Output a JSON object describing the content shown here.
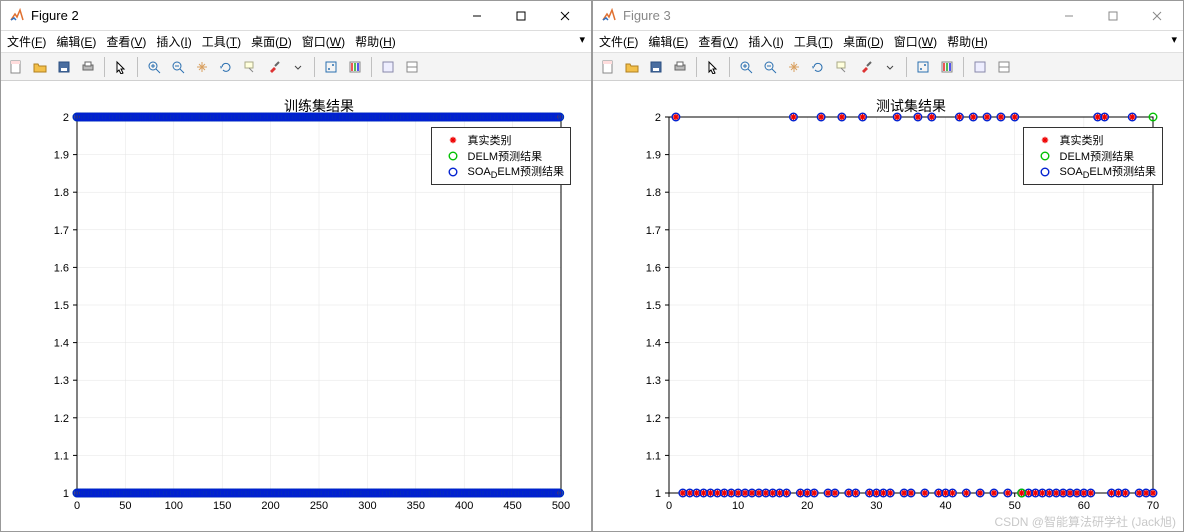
{
  "windows": [
    {
      "title": "Figure 2",
      "active": true,
      "chart": {
        "title": "训练集结果",
        "xticks": [
          0,
          50,
          100,
          150,
          200,
          250,
          300,
          350,
          400,
          450,
          500
        ],
        "yticks": [
          1,
          1.1,
          1.2,
          1.3,
          1.4,
          1.5,
          1.6,
          1.7,
          1.8,
          1.9,
          2
        ],
        "xlim": [
          0,
          500
        ],
        "ylim": [
          1,
          2
        ]
      }
    },
    {
      "title": "Figure 3",
      "active": false,
      "chart": {
        "title": "测试集结果",
        "xticks": [
          0,
          10,
          20,
          30,
          40,
          50,
          60,
          70
        ],
        "yticks": [
          1,
          1.1,
          1.2,
          1.3,
          1.4,
          1.5,
          1.6,
          1.7,
          1.8,
          1.9,
          2
        ],
        "xlim": [
          0,
          70
        ],
        "ylim": [
          1,
          2
        ]
      }
    }
  ],
  "menu": {
    "file": "文件(F)",
    "edit": "编辑(E)",
    "view": "查看(V)",
    "insert": "插入(I)",
    "tools": "工具(T)",
    "desktop": "桌面(D)",
    "window": "窗口(W)",
    "help": "帮助(H)"
  },
  "legend": {
    "real": "真实类别",
    "delm": "DELM预测结果",
    "soa_prefix": "SOA",
    "soa_sub": "D",
    "soa_suffix": "ELM预测结果"
  },
  "watermark": "CSDN @智能算法研学社 (Jack旭)",
  "chart_data": [
    {
      "type": "scatter",
      "title": "训练集结果",
      "xlabel": "",
      "ylabel": "",
      "xlim": [
        0,
        500
      ],
      "ylim": [
        1,
        2
      ],
      "note": "Dense markers on y=1 and y=2 across full x range; series overlap",
      "series": [
        {
          "name": "真实类别",
          "marker": "red-asterisk",
          "y_at_1": "x≈0..500 dense",
          "y_at_2": "x≈0..500 dense"
        },
        {
          "name": "DELM预测结果",
          "marker": "green-open-circle",
          "y_at_1": "x≈0..500 dense",
          "y_at_2": "x≈0..500 dense"
        },
        {
          "name": "SOA_D ELM预测结果",
          "marker": "blue-open-circle",
          "y_at_1": "x≈0..500 dense",
          "y_at_2": "x≈0..500 dense"
        }
      ]
    },
    {
      "type": "scatter",
      "title": "测试集结果",
      "xlabel": "",
      "ylabel": "",
      "xlim": [
        0,
        70
      ],
      "ylim": [
        1,
        2
      ],
      "series": [
        {
          "name": "真实类别",
          "marker": "red-asterisk",
          "points_y2": [
            1,
            18,
            22,
            25,
            28,
            33,
            36,
            38,
            42,
            44,
            46,
            48,
            50,
            62,
            63,
            67
          ],
          "points_y1": [
            2,
            3,
            4,
            5,
            6,
            7,
            8,
            9,
            10,
            11,
            12,
            13,
            14,
            15,
            16,
            17,
            19,
            20,
            21,
            23,
            24,
            26,
            27,
            29,
            30,
            31,
            32,
            34,
            35,
            37,
            39,
            40,
            41,
            43,
            45,
            47,
            49,
            51,
            52,
            53,
            54,
            55,
            56,
            57,
            58,
            59,
            60,
            61,
            64,
            65,
            66,
            68,
            69,
            70
          ]
        },
        {
          "name": "DELM预测结果",
          "marker": "green-open-circle",
          "points_y2": [
            70
          ],
          "points_y1": [
            51
          ]
        },
        {
          "name": "SOA_D ELM预测结果",
          "marker": "blue-open-circle",
          "points_y2": [
            1,
            18,
            22,
            25,
            28,
            33,
            36,
            38,
            42,
            44,
            46,
            48,
            50,
            62,
            63,
            67
          ],
          "points_y1": [
            2,
            3,
            4,
            5,
            6,
            7,
            8,
            9,
            10,
            11,
            12,
            13,
            14,
            15,
            16,
            17,
            19,
            20,
            21,
            23,
            24,
            26,
            27,
            29,
            30,
            31,
            32,
            34,
            35,
            37,
            39,
            40,
            41,
            43,
            45,
            47,
            49,
            51,
            52,
            53,
            54,
            55,
            56,
            57,
            58,
            59,
            60,
            61,
            64,
            65,
            66,
            68,
            69,
            70
          ]
        }
      ]
    }
  ]
}
